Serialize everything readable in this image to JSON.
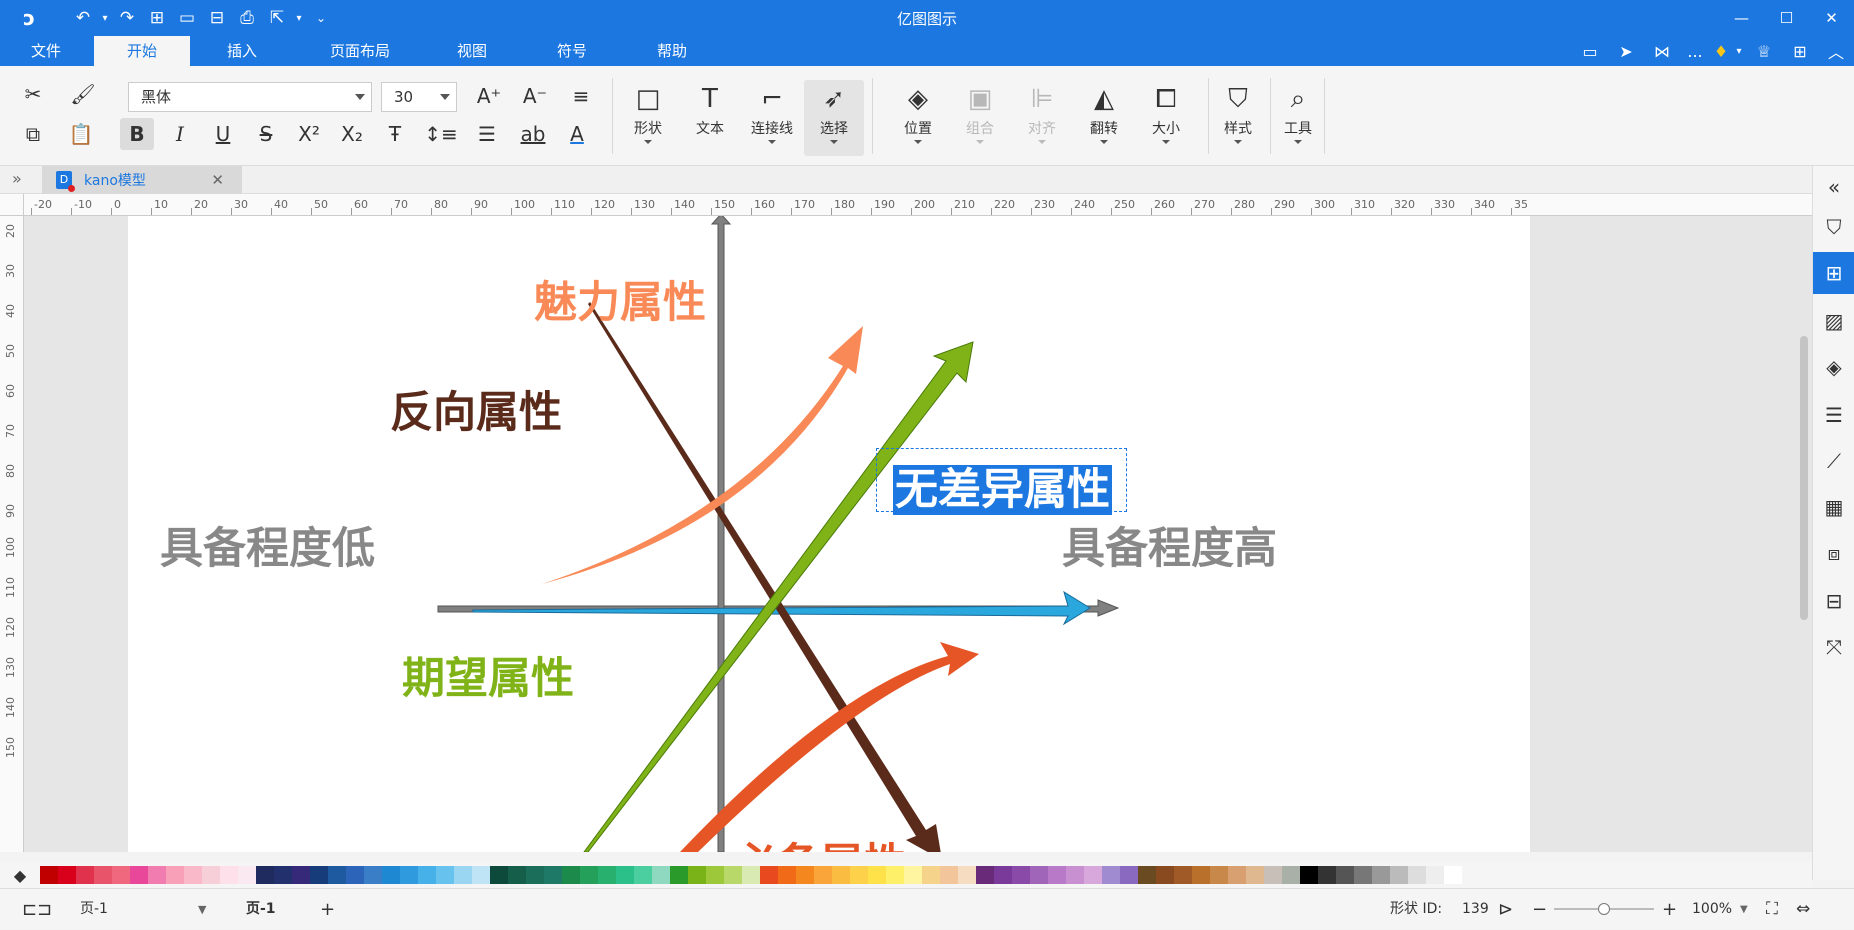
{
  "app": {
    "title": "亿图图示",
    "quick_access": [
      "logo-icon",
      "undo-icon",
      "redo-icon",
      "new-icon",
      "open-icon",
      "save-icon",
      "print-icon",
      "export-icon",
      "customize-icon"
    ]
  },
  "menu": {
    "items": [
      "文件",
      "开始",
      "插入",
      "页面布局",
      "视图",
      "符号",
      "帮助"
    ],
    "active": "开始",
    "right_more": "..."
  },
  "ribbon": {
    "font_name": "黑体",
    "font_size": "30",
    "big_buttons": {
      "shape": "形状",
      "text": "文本",
      "connector": "连接线",
      "select": "选择",
      "position": "位置",
      "group": "组合",
      "align": "对齐",
      "flip": "翻转",
      "size": "大小",
      "style": "样式",
      "tools": "工具"
    }
  },
  "document": {
    "tab_label": "kano模型",
    "tab_icon_letter": "D"
  },
  "rulers": {
    "h": [
      "-20",
      "-10",
      "0",
      "10",
      "20",
      "30",
      "40",
      "50",
      "60",
      "70",
      "80",
      "90",
      "100",
      "110",
      "120",
      "130",
      "140",
      "150",
      "160",
      "170",
      "180",
      "190",
      "200",
      "210",
      "220",
      "230",
      "240",
      "250",
      "260",
      "270",
      "280",
      "290",
      "300",
      "310",
      "320",
      "330",
      "340",
      "35"
    ],
    "v": [
      "20",
      "30",
      "40",
      "50",
      "60",
      "70",
      "80",
      "90",
      "100",
      "110",
      "120",
      "130",
      "140",
      "150"
    ]
  },
  "diagram": {
    "labels": {
      "attractive": "魅力属性",
      "reverse": "反向属性",
      "indifferent": "无差异属性",
      "low": "具备程度低",
      "high": "具备程度高",
      "expected": "期望属性",
      "must_be": "必备属性"
    },
    "colors": {
      "attractive": "#f98a57",
      "reverse": "#5a2a1a",
      "indifferent": "#ffffff",
      "axis_text": "#888888",
      "expected": "#7fb317",
      "must_be": "#e55525",
      "blue_arrow": "#2aa7dc",
      "axis": "#808080",
      "selection": "#1c78e0"
    }
  },
  "palette": [
    "#c00000",
    "#d9001b",
    "#e0314d",
    "#e8556a",
    "#f0687e",
    "#e8479a",
    "#f07cb0",
    "#f8a0b8",
    "#fab9c8",
    "#f6cfd8",
    "#fde0ea",
    "#fbe9f1",
    "#1f2b5e",
    "#23306e",
    "#36297a",
    "#173c7a",
    "#1e5aa0",
    "#2b64b8",
    "#3b7ec8",
    "#1e88d2",
    "#2f9bde",
    "#46b0e8",
    "#68c2ee",
    "#9ad5f2",
    "#bfe4f6",
    "#0e4a3c",
    "#155e4a",
    "#1b6f5a",
    "#1e7a66",
    "#1b8a4a",
    "#24a05a",
    "#28b06e",
    "#2bbf8a",
    "#4ccfa0",
    "#8fd9c0",
    "#2a9a2a",
    "#7ab317",
    "#9cc83a",
    "#b9d86a",
    "#d9eab2",
    "#e8491e",
    "#f06a18",
    "#f5871f",
    "#f9a53a",
    "#fbbc42",
    "#fdd14a",
    "#ffe24a",
    "#fff06a",
    "#fff5a0",
    "#f6d38a",
    "#f2c69a",
    "#f6dcc0",
    "#6a2a7a",
    "#7a3a9a",
    "#8a4aa8",
    "#a064b8",
    "#b87ac8",
    "#c890d0",
    "#d8a8dc",
    "#a08ad0",
    "#8a6ac0",
    "#6a4a20",
    "#8a4a20",
    "#a05a28",
    "#b8702a",
    "#c8884a",
    "#d8a070",
    "#e0b890",
    "#c8c0b8",
    "#a8b0a8",
    "#000000",
    "#333333",
    "#555555",
    "#777777",
    "#999999",
    "#bbbbbb",
    "#dddddd",
    "#eeeeee",
    "#ffffff"
  ],
  "status": {
    "page_selector": "页-1",
    "page_tab": "页-1",
    "add_page": "+",
    "shape_id_label": "形状 ID:",
    "shape_id": "139",
    "zoom_minus": "−",
    "zoom_plus": "+",
    "zoom": "100%",
    "zoom_level": 0.5
  }
}
